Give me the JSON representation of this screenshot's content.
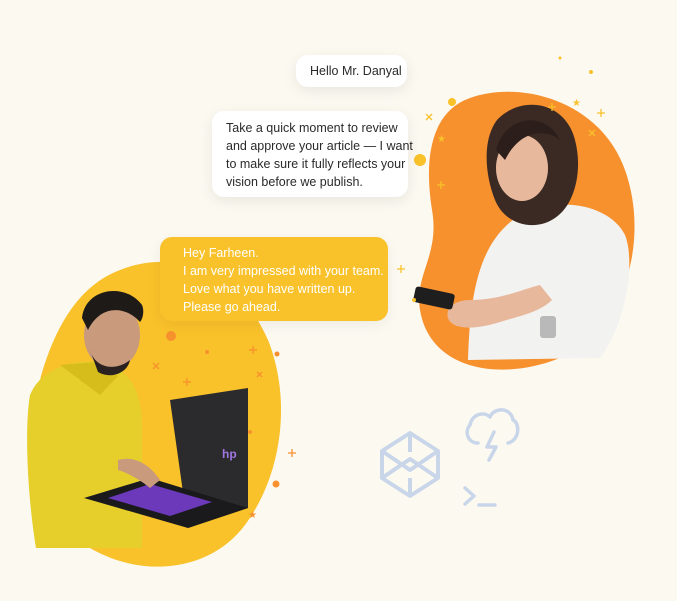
{
  "messages": {
    "greeting": "Hello Mr. Danyal",
    "request": [
      "Take a quick moment to review",
      "and approve your article — I want",
      "to make sure it fully reflects your",
      "vision before we publish."
    ],
    "reply": [
      "Hey Farheen.",
      "I am very impressed with your team.",
      "Love what you have written up.",
      "Please go ahead."
    ]
  },
  "colors": {
    "background": "#fcf9f1",
    "blob_orange": "#f7912e",
    "blob_yellow": "#f9c12a",
    "reply_bubble": "#f9c12a",
    "decor_icons": "#c9d6ea"
  },
  "icons": [
    "cloud-lightning-icon",
    "codepen-icon",
    "terminal-prompt-icon"
  ]
}
